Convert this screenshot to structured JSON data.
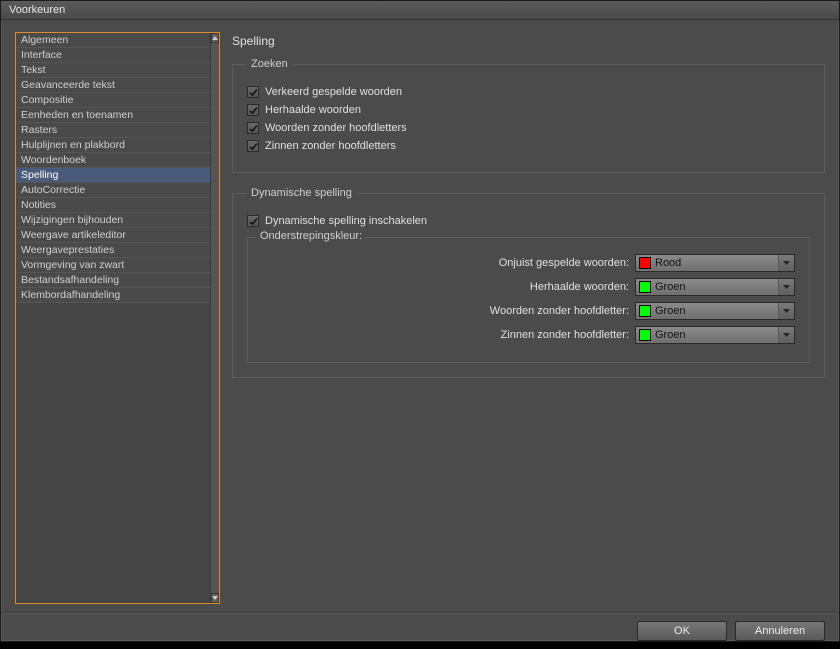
{
  "window": {
    "title": "Voorkeuren"
  },
  "sidebar": {
    "items": [
      {
        "label": "Algemeen"
      },
      {
        "label": "Interface"
      },
      {
        "label": "Tekst"
      },
      {
        "label": "Geavanceerde tekst"
      },
      {
        "label": "Compositie"
      },
      {
        "label": "Eenheden en toenamen"
      },
      {
        "label": "Rasters"
      },
      {
        "label": "Hulplijnen en plakbord"
      },
      {
        "label": "Woordenboek"
      },
      {
        "label": "Spelling"
      },
      {
        "label": "AutoCorrectie"
      },
      {
        "label": "Notities"
      },
      {
        "label": "Wijzigingen bijhouden"
      },
      {
        "label": "Weergave artikeleditor"
      },
      {
        "label": "Weergaveprestaties"
      },
      {
        "label": "Vormgeving van zwart"
      },
      {
        "label": "Bestandsafhandeling"
      },
      {
        "label": "Klembordafhandeling"
      }
    ],
    "selected_index": 9
  },
  "main": {
    "title": "Spelling",
    "find": {
      "legend": "Zoeken",
      "checks": [
        {
          "label": "Verkeerd gespelde woorden",
          "checked": true
        },
        {
          "label": "Herhaalde woorden",
          "checked": true
        },
        {
          "label": "Woorden zonder hoofdletters",
          "checked": true
        },
        {
          "label": "Zinnen zonder hoofdletters",
          "checked": true
        }
      ]
    },
    "dynamic": {
      "legend": "Dynamische spelling",
      "enable": {
        "label": "Dynamische spelling inschakelen",
        "checked": true
      },
      "underline": {
        "legend": "Onderstrepingskleur:",
        "rows": [
          {
            "label": "Onjuist gespelde woorden:",
            "color_name": "Rood",
            "color_hex": "#ff0000"
          },
          {
            "label": "Herhaalde woorden:",
            "color_name": "Groen",
            "color_hex": "#00ff00"
          },
          {
            "label": "Woorden zonder hoofdletter:",
            "color_name": "Groen",
            "color_hex": "#00ff00"
          },
          {
            "label": "Zinnen zonder hoofdletter:",
            "color_name": "Groen",
            "color_hex": "#00ff00"
          }
        ]
      }
    }
  },
  "footer": {
    "ok": "OK",
    "cancel": "Annuleren"
  }
}
